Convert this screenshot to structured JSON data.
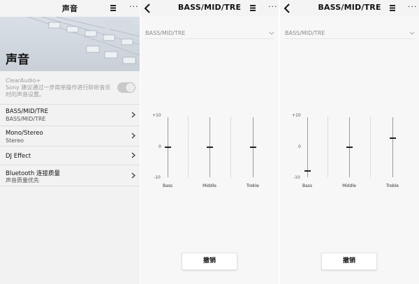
{
  "sound_screen": {
    "title": "声音",
    "hero_title": "声音",
    "clear_audio": {
      "name": "ClearAudio+",
      "description": "Sony 建议通过一步简单操作进行聆听音乐时的声音设置。"
    },
    "items": [
      {
        "label": "BASS/MID/TRE",
        "value": "BASS/MID/TRE"
      },
      {
        "label": "Mono/Stereo",
        "value": "Stereo"
      },
      {
        "label": "DJ Effect",
        "value": ""
      },
      {
        "label": "Bluetooth 连接质量",
        "value": "声音质量优先"
      }
    ]
  },
  "eq_screens": [
    {
      "title": "BASS/MID/TRE",
      "selector_value": "BASS/MID/TRE",
      "ticks": {
        "top": "+10",
        "mid": "0",
        "bottom": "-10"
      },
      "bands": [
        {
          "label": "Bass",
          "value": 0
        },
        {
          "label": "Middle",
          "value": 0
        },
        {
          "label": "Treble",
          "value": 0
        }
      ],
      "button_label": "撤销"
    },
    {
      "title": "BASS/MID/TRE",
      "selector_value": "BASS/MID/TRE",
      "ticks": {
        "top": "+10",
        "mid": "0",
        "bottom": "-10"
      },
      "bands": [
        {
          "label": "Bass",
          "value": -8
        },
        {
          "label": "Middle",
          "value": 0
        },
        {
          "label": "Treble",
          "value": 3
        }
      ],
      "button_label": "撤销"
    }
  ],
  "colors": {
    "accent": "#111111",
    "track": "#999999",
    "toggle_off": "#c9c9c9"
  }
}
